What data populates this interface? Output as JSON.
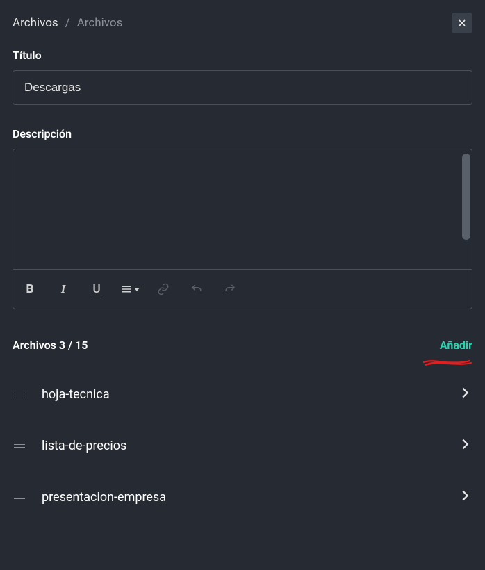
{
  "breadcrumb": {
    "primary": "Archivos",
    "separator": "/",
    "secondary": "Archivos"
  },
  "fields": {
    "title_label": "Título",
    "title_value": "Descargas",
    "description_label": "Descripción",
    "description_value": ""
  },
  "toolbar": {
    "bold": "B",
    "italic": "I",
    "underline": "U"
  },
  "files_section": {
    "label": "Archivos 3 / 15",
    "add_label": "Añadir"
  },
  "files": [
    {
      "name": "hoja-tecnica"
    },
    {
      "name": "lista-de-precios"
    },
    {
      "name": "presentacion-empresa"
    }
  ]
}
